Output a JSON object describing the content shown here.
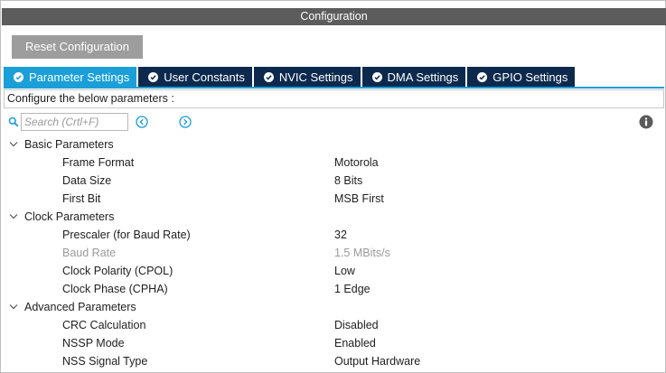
{
  "window": {
    "title": "Configuration"
  },
  "toolbar": {
    "reset_label": "Reset Configuration"
  },
  "tabs": [
    {
      "label": "Parameter Settings",
      "active": true,
      "icon": "check-circle-icon"
    },
    {
      "label": "User Constants",
      "active": false,
      "icon": "check-circle-icon"
    },
    {
      "label": "NVIC Settings",
      "active": false,
      "icon": "check-circle-icon"
    },
    {
      "label": "DMA Settings",
      "active": false,
      "icon": "check-circle-icon"
    },
    {
      "label": "GPIO Settings",
      "active": false,
      "icon": "check-circle-icon"
    }
  ],
  "instructions": "Configure the below parameters :",
  "search": {
    "placeholder": "Search (Crtl+F)",
    "value": ""
  },
  "groups": [
    {
      "label": "Basic Parameters",
      "params": [
        {
          "name": "Frame Format",
          "value": "Motorola",
          "disabled": false
        },
        {
          "name": "Data Size",
          "value": "8 Bits",
          "disabled": false
        },
        {
          "name": "First Bit",
          "value": "MSB First",
          "disabled": false
        }
      ]
    },
    {
      "label": "Clock Parameters",
      "params": [
        {
          "name": "Prescaler (for Baud Rate)",
          "value": "32",
          "disabled": false
        },
        {
          "name": "Baud Rate",
          "value": "1.5 MBits/s",
          "disabled": true
        },
        {
          "name": "Clock Polarity (CPOL)",
          "value": "Low",
          "disabled": false
        },
        {
          "name": "Clock Phase (CPHA)",
          "value": "1 Edge",
          "disabled": false
        }
      ]
    },
    {
      "label": "Advanced Parameters",
      "params": [
        {
          "name": "CRC Calculation",
          "value": "Disabled",
          "disabled": false
        },
        {
          "name": "NSSP Mode",
          "value": "Enabled",
          "disabled": false
        },
        {
          "name": "NSS Signal Type",
          "value": "Output Hardware",
          "disabled": false
        }
      ]
    }
  ],
  "colors": {
    "titlebar": "#5c5c5c",
    "tab_active": "#1a9fd9",
    "tab_inactive": "#0d2a4e",
    "reset_button": "#9d9d9d",
    "accent_icon": "#1a9fd9",
    "disabled_text": "#9a9a9a"
  }
}
